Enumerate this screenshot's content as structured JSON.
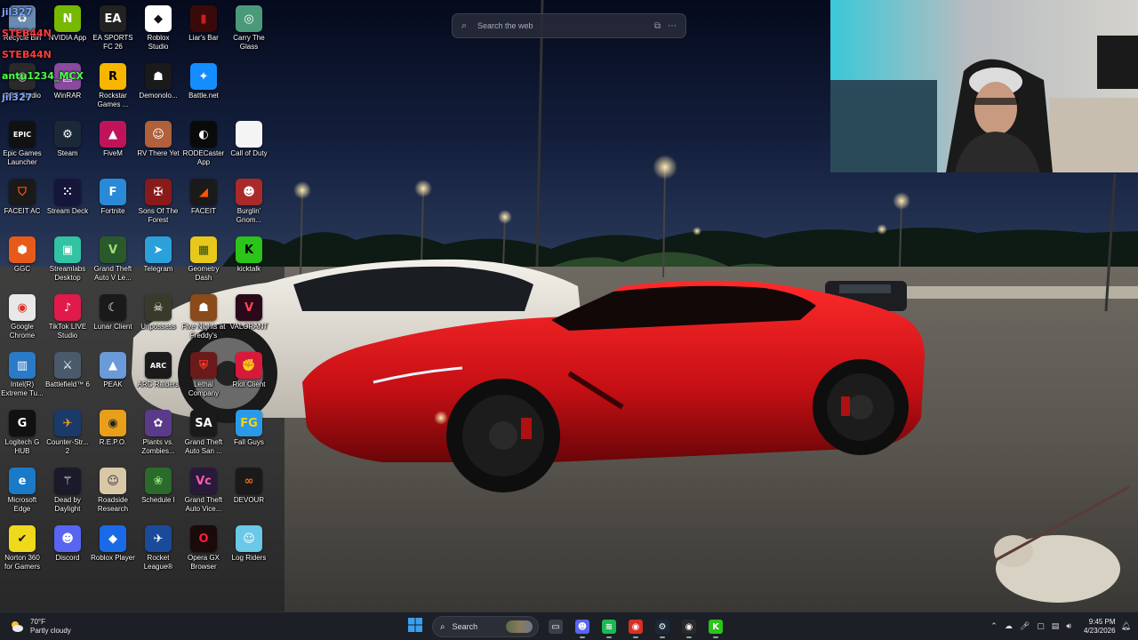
{
  "search": {
    "placeholder": "Search the web",
    "icon": "search-icon",
    "right_icons": [
      "visual-search-icon",
      "more-icon"
    ]
  },
  "chat": [
    {
      "user": "jil327",
      "text": "",
      "color": "#7fa8ff"
    },
    {
      "user": "STEB44N",
      "text": "",
      "color": "#ff3b3b"
    },
    {
      "user": "STEB44N",
      "text": "",
      "color": "#ff3b3b"
    },
    {
      "user": "antu1234_MCX",
      "text": "",
      "color": "#4cff4c"
    },
    {
      "user": "jil327",
      "text": "",
      "color": "#7fa8ff"
    }
  ],
  "desktop_icons": [
    {
      "label": "Recycle Bin",
      "icon": "recycle-bin-icon",
      "color": "#6a8ab0",
      "glyph": "♻"
    },
    {
      "label": "NVIDIA App",
      "icon": "nvidia-icon",
      "color": "#76b900",
      "glyph": "N"
    },
    {
      "label": "EA SPORTS\nFC 26",
      "icon": "ea-fc-icon",
      "color": "#222222",
      "glyph": "EA"
    },
    {
      "label": "Roblox\nStudio",
      "icon": "roblox-studio-icon",
      "color": "#ffffff",
      "glyph": "◆",
      "fg": "#111"
    },
    {
      "label": "Liar's Bar",
      "icon": "liars-bar-icon",
      "color": "#3a0a0a",
      "glyph": "▮",
      "fg": "#c62020"
    },
    {
      "label": "Carry The\nGlass",
      "icon": "carry-glass-icon",
      "color": "#4a9a7a",
      "glyph": "◎"
    },
    {
      "label": "OBS Studio",
      "icon": "obs-icon",
      "color": "#2a2a2a",
      "glyph": "◉"
    },
    {
      "label": "WinRAR",
      "icon": "winrar-icon",
      "color": "#8a4aa0",
      "glyph": "▤"
    },
    {
      "label": "Rockstar\nGames ...",
      "icon": "rockstar-icon",
      "color": "#f7b500",
      "glyph": "R",
      "fg": "#000"
    },
    {
      "label": "Demonolo...",
      "icon": "demonologist-icon",
      "color": "#1a1a1a",
      "glyph": "☗"
    },
    {
      "label": "Battle.net",
      "icon": "battlenet-icon",
      "color": "#148eff",
      "glyph": "✦"
    },
    {
      "label": "Epic Games\nLauncher",
      "icon": "epic-games-icon",
      "color": "#111111",
      "glyph": "EPIC"
    },
    {
      "label": "Steam",
      "icon": "steam-icon",
      "color": "#1b2838",
      "glyph": "⚙"
    },
    {
      "label": "FiveM",
      "icon": "fivem-icon",
      "color": "#c0145a",
      "glyph": "▲"
    },
    {
      "label": "RV There Yet",
      "icon": "rv-there-yet-icon",
      "color": "#b0603a",
      "glyph": "☺"
    },
    {
      "label": "RODECaster\nApp",
      "icon": "rodecaster-icon",
      "color": "#0a0a0a",
      "glyph": "◐"
    },
    {
      "label": "Call of Duty",
      "icon": "file-icon",
      "color": "#f4f4f4",
      "glyph": "",
      "fg": "#333"
    },
    {
      "label": "FACEIT AC",
      "icon": "faceit-ac-icon",
      "color": "#1a1a1a",
      "glyph": "⛉",
      "fg": "#ff5500"
    },
    {
      "label": "Stream Deck",
      "icon": "stream-deck-icon",
      "color": "#16163a",
      "glyph": "⁙"
    },
    {
      "label": "Fortnite",
      "icon": "fortnite-icon",
      "color": "#2a8ad8",
      "glyph": "F"
    },
    {
      "label": "Sons Of The\nForest",
      "icon": "sons-forest-icon",
      "color": "#8a1a1a",
      "glyph": "✠"
    },
    {
      "label": "FACEIT",
      "icon": "faceit-icon",
      "color": "#1a1a1a",
      "glyph": "◢",
      "fg": "#ff5500"
    },
    {
      "label": "Burglin'\nGnom...",
      "icon": "burglin-gnomes-icon",
      "color": "#aa2a2a",
      "glyph": "☻"
    },
    {
      "label": "GGC",
      "icon": "ggc-icon",
      "color": "#e85a1a",
      "glyph": "⬢"
    },
    {
      "label": "Streamlabs\nDesktop",
      "icon": "streamlabs-icon",
      "color": "#31c3a2",
      "glyph": "▣"
    },
    {
      "label": "Grand Theft\nAuto V Le...",
      "icon": "gta5-icon",
      "color": "#2a5a2a",
      "glyph": "V",
      "fg": "#9ee07a"
    },
    {
      "label": "Telegram",
      "icon": "telegram-icon",
      "color": "#2aa1da",
      "glyph": "➤"
    },
    {
      "label": "Geometry\nDash",
      "icon": "geometry-dash-icon",
      "color": "#e8c81a",
      "glyph": "▦",
      "fg": "#2a4a1a"
    },
    {
      "label": "kicktalk",
      "icon": "kicktalk-icon",
      "color": "#2ac41a",
      "glyph": "K",
      "fg": "#000"
    },
    {
      "label": "Google\nChrome",
      "icon": "chrome-icon",
      "color": "#e8e8e8",
      "glyph": "◉",
      "fg": "#d93025"
    },
    {
      "label": "TikTok LIVE\nStudio",
      "icon": "tiktok-live-icon",
      "color": "#e01a4a",
      "glyph": "♪"
    },
    {
      "label": "Lunar Client",
      "icon": "lunar-client-icon",
      "color": "#1a1a1a",
      "glyph": "☾"
    },
    {
      "label": "Unpossess",
      "icon": "unpossess-icon",
      "color": "#3a3a2a",
      "glyph": "☠"
    },
    {
      "label": "Five Nights at\nFreddy's",
      "icon": "fnaf-icon",
      "color": "#8a4a1a",
      "glyph": "☗"
    },
    {
      "label": "VALORANT",
      "icon": "valorant-icon",
      "color": "#2a0a1a",
      "glyph": "V",
      "fg": "#ff4655"
    },
    {
      "label": "Intel(R)\nExtreme Tu...",
      "icon": "intel-xtu-icon",
      "color": "#2a7ac8",
      "glyph": "▥"
    },
    {
      "label": "Battlefield™ 6",
      "icon": "battlefield-icon",
      "color": "#4a5a6a",
      "glyph": "⚔"
    },
    {
      "label": "PEAK",
      "icon": "peak-icon",
      "color": "#6a9ad8",
      "glyph": "▲"
    },
    {
      "label": "ARC Raiders",
      "icon": "arc-raiders-icon",
      "color": "#1a1a1a",
      "glyph": "ARC"
    },
    {
      "label": "Lethal\nCompany",
      "icon": "lethal-company-icon",
      "color": "#6a1a1a",
      "glyph": "⛨",
      "fg": "#ff3a2a"
    },
    {
      "label": "Riot Client",
      "icon": "riot-client-icon",
      "color": "#d7193a",
      "glyph": "✊"
    },
    {
      "label": "Logitech G\nHUB",
      "icon": "logitech-ghub-icon",
      "color": "#111111",
      "glyph": "G"
    },
    {
      "label": "Counter-Str...\n2",
      "icon": "cs2-icon",
      "color": "#1a3a6a",
      "glyph": "✈",
      "fg": "#f0a020"
    },
    {
      "label": "R.E.P.O.",
      "icon": "repo-icon",
      "color": "#e8a01a",
      "glyph": "◉",
      "fg": "#222"
    },
    {
      "label": "Plants vs.\nZombies...",
      "icon": "pvz-icon",
      "color": "#5a3a8a",
      "glyph": "✿"
    },
    {
      "label": "Grand Theft\nAuto San ...",
      "icon": "gta-sa-icon",
      "color": "#1a1a1a",
      "glyph": "SA"
    },
    {
      "label": "Fall Guys",
      "icon": "fall-guys-icon",
      "color": "#2a9ae8",
      "glyph": "FG",
      "fg": "#ffd200"
    },
    {
      "label": "Microsoft\nEdge",
      "icon": "edge-icon",
      "color": "#1a7ac8",
      "glyph": "e"
    },
    {
      "label": "Dead by\nDaylight",
      "icon": "dbd-icon",
      "color": "#1a1a2a",
      "glyph": "⚚"
    },
    {
      "label": "Roadside\nResearch",
      "icon": "roadside-research-icon",
      "color": "#d8c8a8",
      "glyph": "☺",
      "fg": "#333"
    },
    {
      "label": "Schedule I",
      "icon": "schedule-one-icon",
      "color": "#2a6a2a",
      "glyph": "❀",
      "fg": "#8ee07a"
    },
    {
      "label": "Grand Theft\nAuto Vice...",
      "icon": "gta-vice-icon",
      "color": "#2a1a3a",
      "glyph": "Vc",
      "fg": "#ff5ab0"
    },
    {
      "label": "DEVOUR",
      "icon": "devour-icon",
      "color": "#1a1a1a",
      "glyph": "∞",
      "fg": "#e86a1a"
    },
    {
      "label": "Norton 360\nfor Gamers",
      "icon": "norton-icon",
      "color": "#f0d81a",
      "glyph": "✔",
      "fg": "#111"
    },
    {
      "label": "Discord",
      "icon": "discord-icon",
      "color": "#5865f2",
      "glyph": "☻"
    },
    {
      "label": "Roblox Player",
      "icon": "roblox-player-icon",
      "color": "#1a6ae8",
      "glyph": "◆"
    },
    {
      "label": "Rocket\nLeague®",
      "icon": "rocket-league-icon",
      "color": "#1a4a9a",
      "glyph": "✈"
    },
    {
      "label": "Opera GX\nBrowser",
      "icon": "opera-gx-icon",
      "color": "#1a0a0a",
      "glyph": "O",
      "fg": "#ff1a3a"
    },
    {
      "label": "Log Riders",
      "icon": "log-riders-icon",
      "color": "#6ac8e8",
      "glyph": "☺"
    }
  ],
  "taskbar": {
    "weather": {
      "temp": "70°F",
      "condition": "Partly cloudy",
      "icon": "weather-partly-cloudy-icon"
    },
    "start_icon": "windows-start-icon",
    "search_label": "Search",
    "apps": [
      {
        "name": "task-view-icon",
        "glyph": "▭",
        "color": "#3a3f49",
        "running": false
      },
      {
        "name": "discord-taskbar-icon",
        "glyph": "☻",
        "color": "#5865f2",
        "running": true
      },
      {
        "name": "spotify-taskbar-icon",
        "glyph": "≋",
        "color": "#1db954",
        "running": true
      },
      {
        "name": "chrome-taskbar-icon",
        "glyph": "◉",
        "color": "#d93025",
        "running": true
      },
      {
        "name": "steam-taskbar-icon",
        "glyph": "⚙",
        "color": "#1b2838",
        "running": true
      },
      {
        "name": "obs-taskbar-icon",
        "glyph": "◉",
        "color": "#2a2a2a",
        "running": true
      },
      {
        "name": "kick-taskbar-icon",
        "glyph": "K",
        "color": "#2ac41a",
        "running": true
      }
    ],
    "tray_icons": [
      "chevron-up-icon",
      "onedrive-icon",
      "microphone-icon",
      "speakers-icon",
      "network-icon",
      "volume-icon"
    ],
    "time": "9:45 PM",
    "date": "4/23/2026",
    "notification_icon": "notification-bell-icon"
  }
}
